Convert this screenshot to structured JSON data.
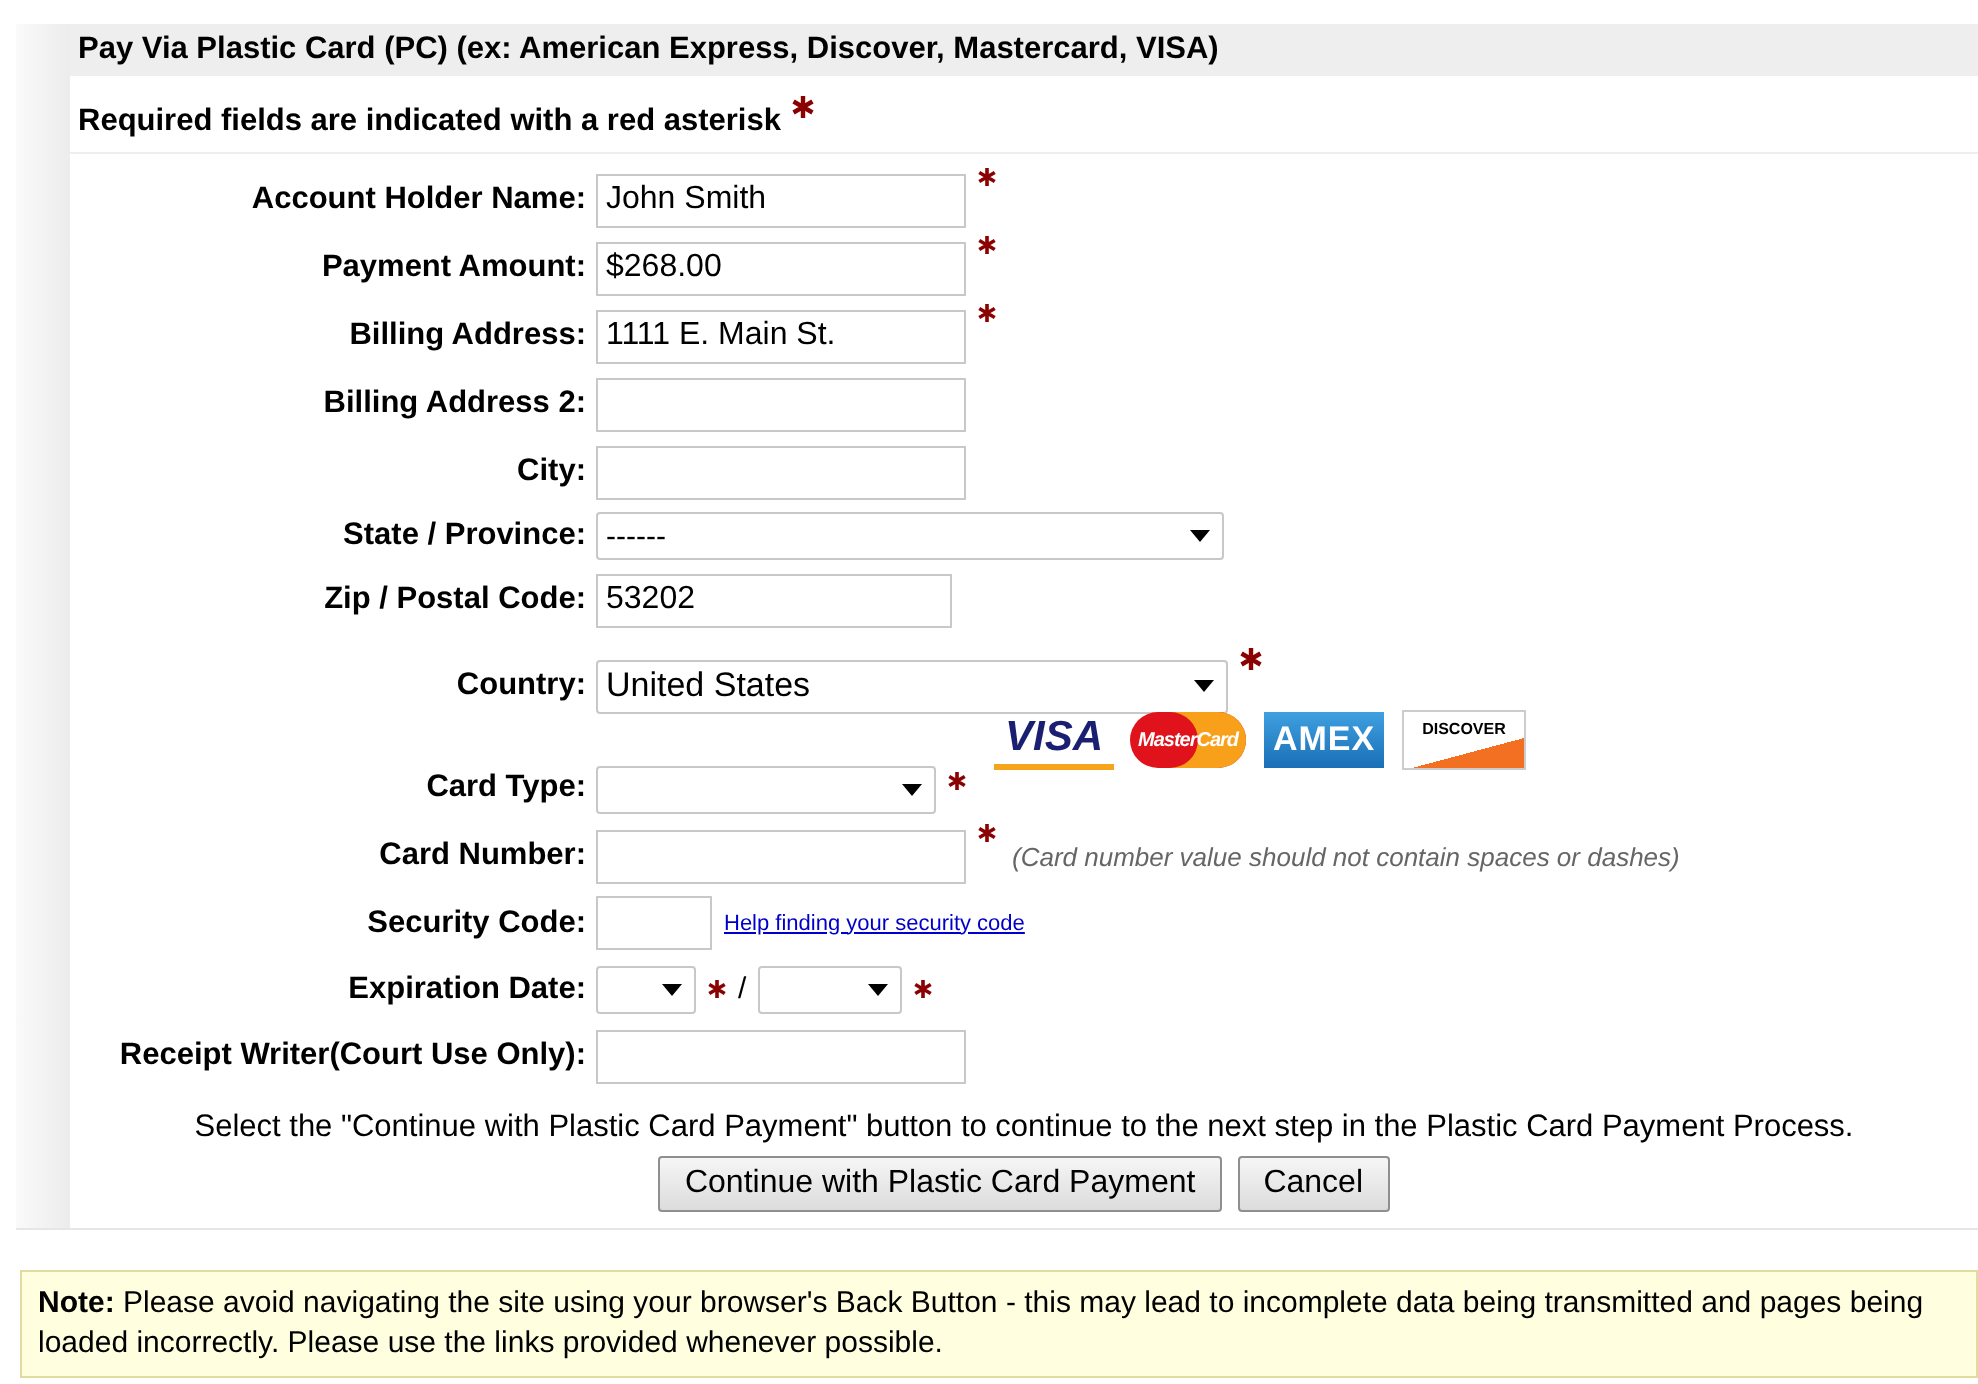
{
  "header": {
    "title": "Pay Via Plastic Card (PC) (ex: American Express, Discover, Mastercard, VISA)"
  },
  "required_note": "Required fields are indicated with a red asterisk",
  "fields": [
    {
      "kind": "text",
      "label": "Account Holder Name:",
      "value": "John Smith",
      "required": true
    },
    {
      "kind": "text",
      "label": "Payment Amount:",
      "value": "$268.00",
      "required": true
    },
    {
      "kind": "text",
      "label": "Billing Address:",
      "value": "1111 E. Main St.",
      "required": true
    },
    {
      "kind": "text",
      "label": "Billing Address 2:",
      "required": false
    },
    {
      "kind": "text",
      "label": "City:",
      "required": false
    },
    {
      "kind": "wide_select",
      "label": "State / Province:",
      "value": "------",
      "required": false
    },
    {
      "kind": "zip",
      "label": "Zip / Postal Code:",
      "value": "53202",
      "required": false
    },
    {
      "kind": "country",
      "label": "Country:",
      "value": "United States",
      "required": true
    },
    {
      "kind": "card_type",
      "label": "Card Type:",
      "required": true,
      "logos": [
        {
          "kind": "visa",
          "text": "VISA"
        },
        {
          "kind": "mastercard",
          "text": "MasterCard"
        },
        {
          "kind": "amex",
          "text": "AMEX"
        },
        {
          "kind": "discover",
          "text": "DISCOVER"
        }
      ]
    },
    {
      "kind": "text",
      "label": "Card Number:",
      "required": true,
      "hint": "(Card number value should not contain spaces or dashes)"
    },
    {
      "kind": "code",
      "label": "Security Code:",
      "required": false,
      "link": "Help finding your security code"
    },
    {
      "kind": "expiry",
      "label": "Expiration Date:",
      "required": true,
      "separator": "/"
    },
    {
      "kind": "text",
      "label": "Receipt Writer(Court Use Only):",
      "required": false
    }
  ],
  "instruction": "Select the \"Continue with Plastic Card Payment\" button to continue to the next step in the Plastic Card Payment Process.",
  "buttons": [
    "Continue with Plastic Card Payment",
    "Cancel"
  ],
  "note": "**Note:** Please avoid navigating the site using your browser's Back Button - this may lead to incomplete data being transmitted and pages being loaded incorrectly. Please use the links provided whenever possible."
}
